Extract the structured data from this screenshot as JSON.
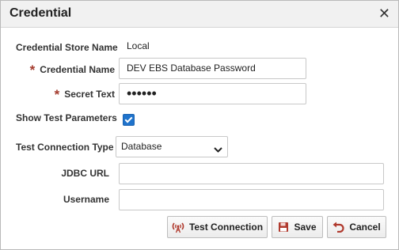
{
  "dialog": {
    "title": "Credential",
    "close_glyph": "✕"
  },
  "form": {
    "store_name": {
      "label": "Credential Store Name",
      "value": "Local"
    },
    "credential_name": {
      "required_mark": "*",
      "label": "Credential Name",
      "value": "DEV EBS Database Password"
    },
    "secret_text": {
      "required_mark": "*",
      "label": "Secret Text",
      "masked_value": "••••••"
    },
    "show_test_params": {
      "label": "Show Test Parameters",
      "checked": true
    },
    "test_connection_type": {
      "label": "Test Connection Type",
      "selected": "Database"
    },
    "jdbc_url": {
      "label": "JDBC URL",
      "value": ""
    },
    "username": {
      "label": "Username",
      "value": ""
    }
  },
  "buttons": {
    "test_connection": {
      "label": "Test Connection",
      "icon": "antenna-icon"
    },
    "save": {
      "label": "Save",
      "icon": "floppy-disk-icon"
    },
    "cancel": {
      "label": "Cancel",
      "icon": "undo-arrow-icon"
    }
  },
  "colors": {
    "required": "#a33a2c",
    "checkbox": "#1f73cc",
    "icon_red": "#b03a2e"
  }
}
